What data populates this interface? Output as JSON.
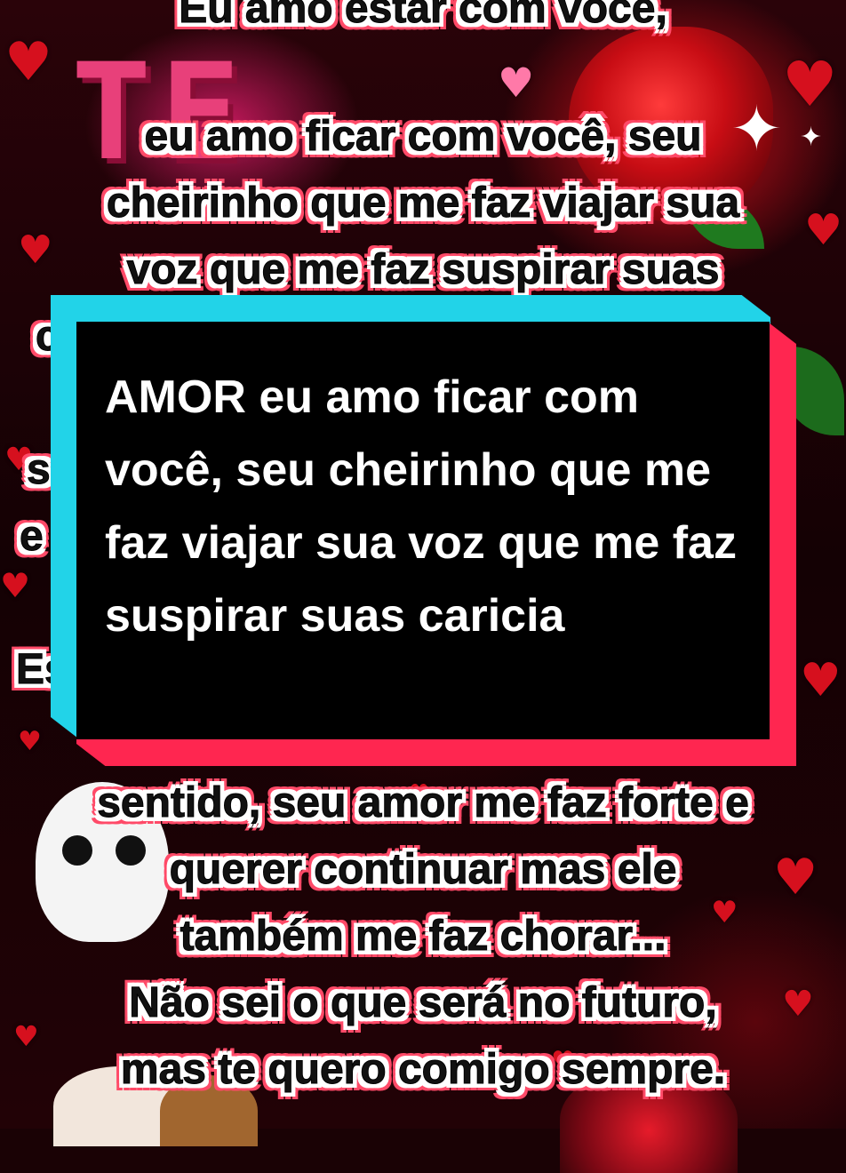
{
  "background_lines": [
    "Eu amo estar com você,",
    "eu amo ficar com você, seu",
    "cheirinho que me faz viajar sua",
    "voz que me faz suspirar suas",
    "sentido, seu amor me faz forte e",
    "querer continuar mas ele",
    "também me faz chorar...",
    "Não sei o que será no futuro,",
    "mas te quero comigo sempre."
  ],
  "edge_fragments": [
    "c",
    "s",
    "e",
    "Es"
  ],
  "decor_letters": "TE",
  "card": {
    "text": "AMOR eu amo ficar com você, seu cheirinho que me faz viajar sua voz que me faz suspirar suas caricia"
  },
  "colors": {
    "card_cyan": "#22d3e8",
    "card_pink": "#ff2650",
    "card_black": "#000000",
    "heart_red": "#d6101e",
    "text_outline_pink": "#ff4a68"
  },
  "icons": [
    "heart-icon",
    "sparkle-icon",
    "rose-icon"
  ]
}
